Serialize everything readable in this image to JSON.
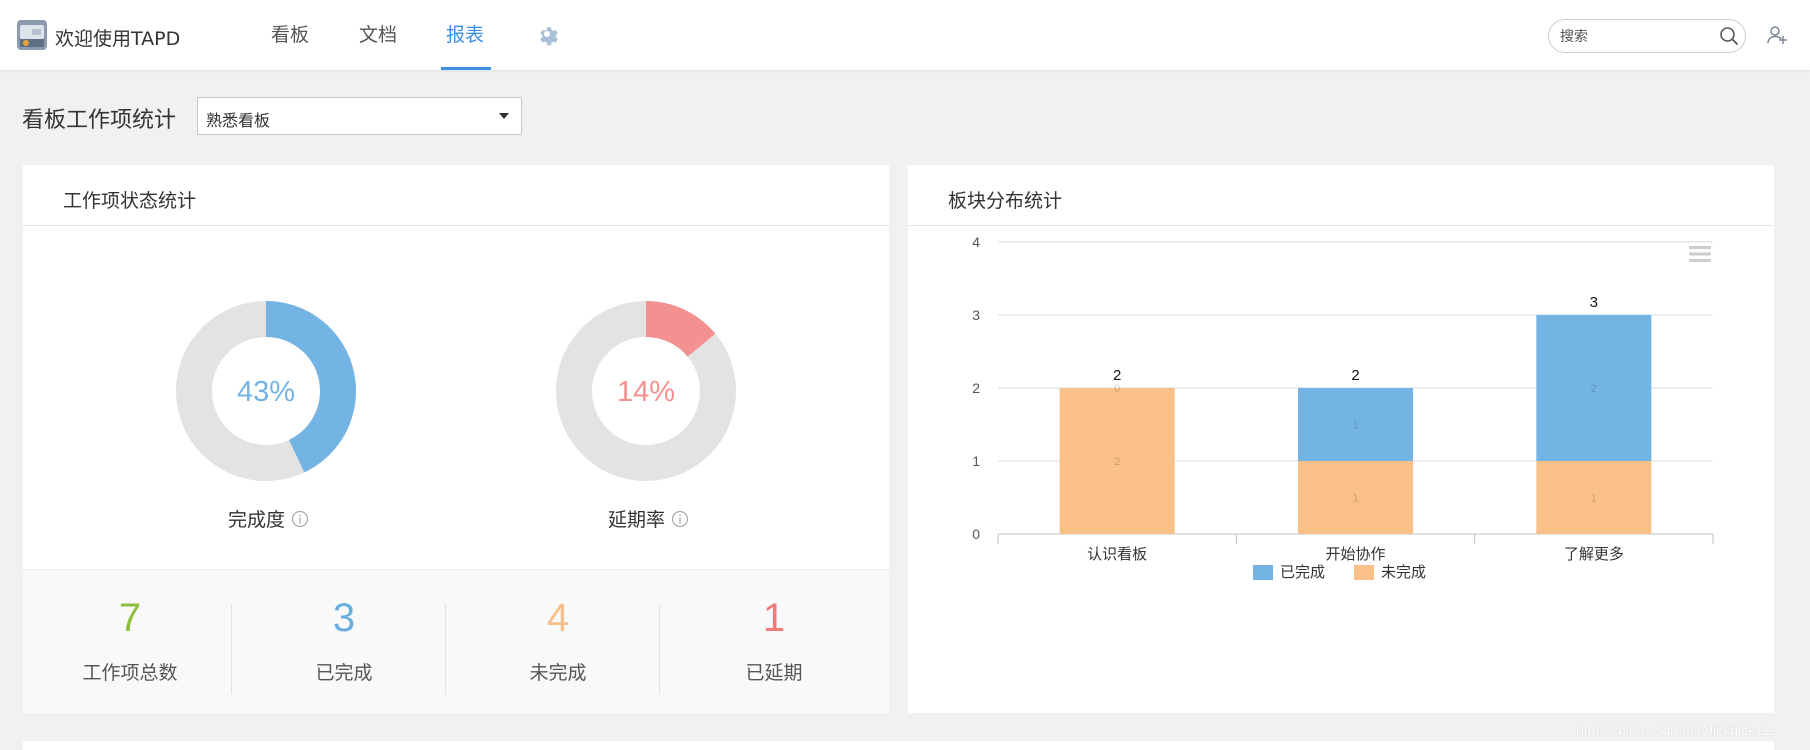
{
  "app": {
    "title": "欢迎使用TAPD"
  },
  "nav": {
    "tabs": [
      {
        "label": "看板",
        "active": false
      },
      {
        "label": "文档",
        "active": false
      },
      {
        "label": "报表",
        "active": true
      }
    ]
  },
  "search": {
    "placeholder": "搜索"
  },
  "page": {
    "title": "看板工作项统计",
    "board_select": {
      "value": "熟悉看板"
    }
  },
  "status_card": {
    "title": "工作项状态统计",
    "completion": {
      "percent_label": "43%",
      "value": 43,
      "label": "完成度",
      "color": "#74b4e4"
    },
    "delay": {
      "percent_label": "14%",
      "value": 14,
      "label": "延期率",
      "color": "#f39090"
    },
    "stats": [
      {
        "value": "7",
        "label": "工作项总数",
        "color": "#8bbf3f"
      },
      {
        "value": "3",
        "label": "已完成",
        "color": "#6aaee0"
      },
      {
        "value": "4",
        "label": "未完成",
        "color": "#f5c08a"
      },
      {
        "value": "1",
        "label": "已延期",
        "color": "#f07b7b"
      }
    ]
  },
  "dist_card": {
    "title": "板块分布统计"
  },
  "chart_data": {
    "type": "bar",
    "stacked": true,
    "categories": [
      "认识看板",
      "开始协作",
      "了解更多"
    ],
    "series": [
      {
        "name": "已完成",
        "values": [
          0,
          1,
          2
        ],
        "color": "#74b4e4"
      },
      {
        "name": "未完成",
        "values": [
          2,
          1,
          1
        ],
        "color": "#f9c087"
      }
    ],
    "totals": [
      2,
      2,
      3
    ],
    "ylim": [
      0,
      4
    ],
    "yticks": [
      0,
      1,
      2,
      3,
      4
    ],
    "grid": true,
    "legend": "bottom-center"
  },
  "watermark": "https://blog.csdn.net/dickdick111"
}
